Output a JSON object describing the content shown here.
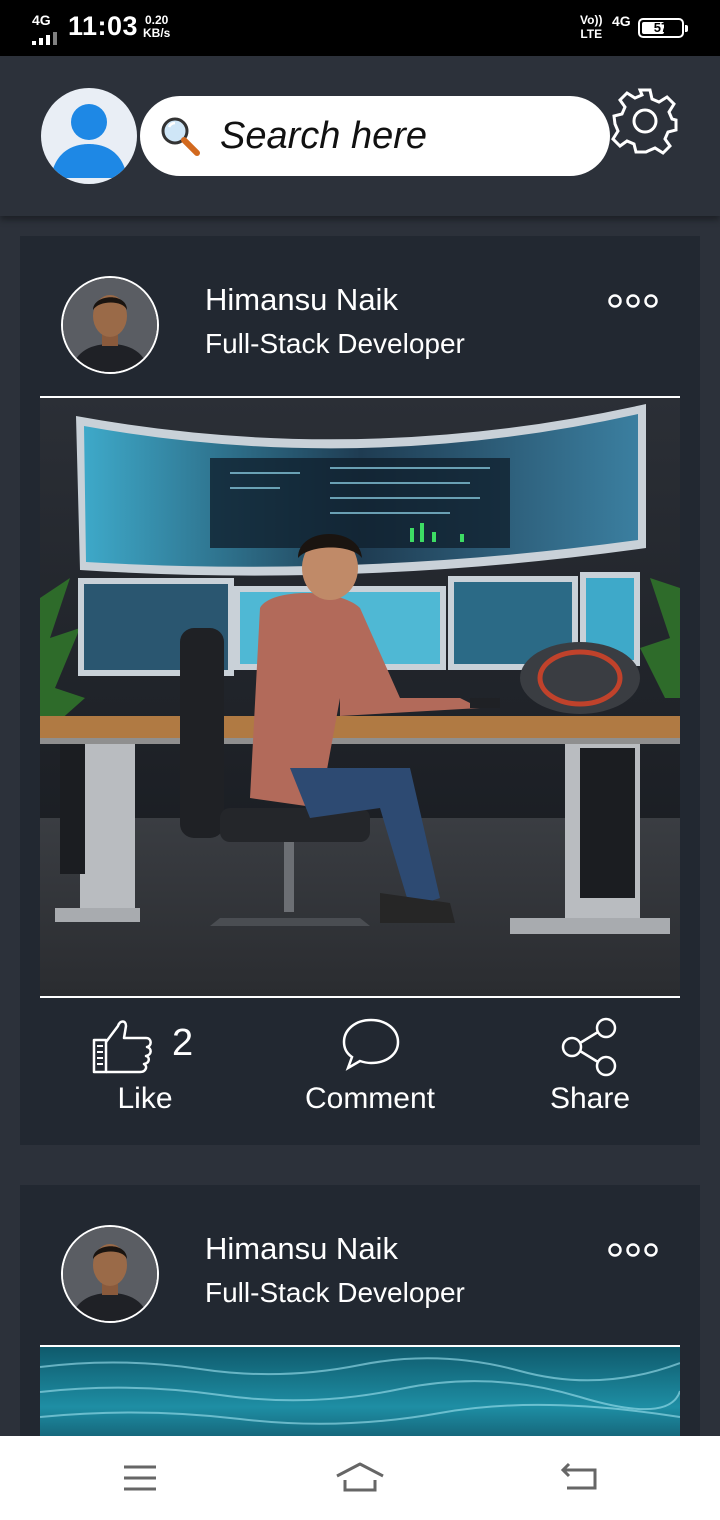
{
  "status_bar": {
    "network": "4G",
    "time": "11:03",
    "speed_value": "0.20",
    "speed_unit": "KB/s",
    "volte_top": "Vo))",
    "volte_bottom": "LTE",
    "network_right": "4G",
    "battery_level": "57",
    "battery_fraction": 0.57
  },
  "header": {
    "search": {
      "placeholder": "Search here"
    },
    "icons": [
      "user-avatar-icon",
      "search-icon",
      "gear-icon"
    ]
  },
  "posts": [
    {
      "author": {
        "name": "Himansu Naik",
        "title": "Full-Stack Developer"
      },
      "image": "developer-at-multi-monitor-desk",
      "actions": {
        "like_label": "Like",
        "like_count": "2",
        "comment_label": "Comment",
        "share_label": "Share"
      }
    },
    {
      "author": {
        "name": "Himansu Naik",
        "title": "Full-Stack Developer"
      },
      "image": "underwater-pool-surface"
    }
  ],
  "nav_bar": {
    "icons": [
      "menu-icon",
      "home-icon",
      "back-icon"
    ]
  },
  "colors": {
    "status_bar": "#000000",
    "background": "#2c313a",
    "card": "#222831",
    "search_bg": "#ffffff",
    "nav_bg": "#ffffff",
    "avatar_blue": "#1e88e5"
  }
}
